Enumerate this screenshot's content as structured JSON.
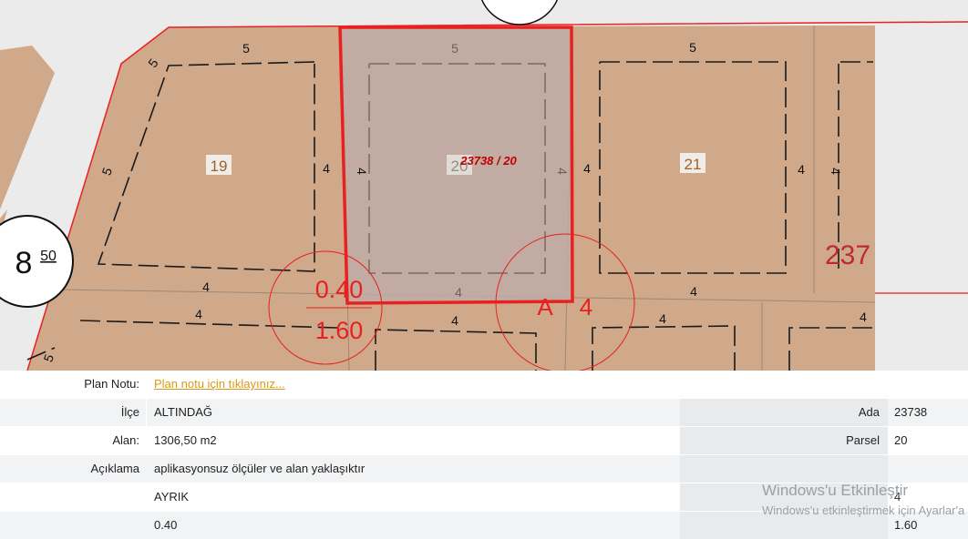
{
  "map": {
    "parcel_numbers": [
      "19",
      "20",
      "21"
    ],
    "selected_label": "23738 / 20",
    "dimensions": [
      "5",
      "4"
    ],
    "setback_front": "0.40",
    "setback_back": "1.60",
    "zone_letter": "A",
    "zone_floors": "4",
    "partial_label": "237",
    "road_width_main": "8",
    "road_width_sup": "50",
    "colors": {
      "parcel_fill": "#cfa98a",
      "selected_fill": "#bfaca6",
      "boundary_red": "#e82020",
      "road": "#ebebeb"
    }
  },
  "info": {
    "plan_note_label": "Plan Notu:",
    "plan_note_link": "Plan notu için tıklayınız...",
    "ilce_label": "İlçe",
    "ilce_value": "ALTINDAĞ",
    "ada_label": "Ada",
    "ada_value": "23738",
    "alan_label": "Alan:",
    "alan_value": "1306,50 m2",
    "parsel_label": "Parsel",
    "parsel_value": "20",
    "aciklama_label": "Açıklama",
    "aciklama_value": "aplikasyonsuz ölçüler ve alan yaklaşıktır",
    "nizam_value": "AYRIK",
    "kat_value": "4",
    "taks_value": "0.40",
    "kaks_value": "1.60"
  },
  "watermark": {
    "title": "Windows'u Etkinleştir",
    "subtitle": "Windows'u etkinleştirmek için Ayarlar'a gidin."
  }
}
